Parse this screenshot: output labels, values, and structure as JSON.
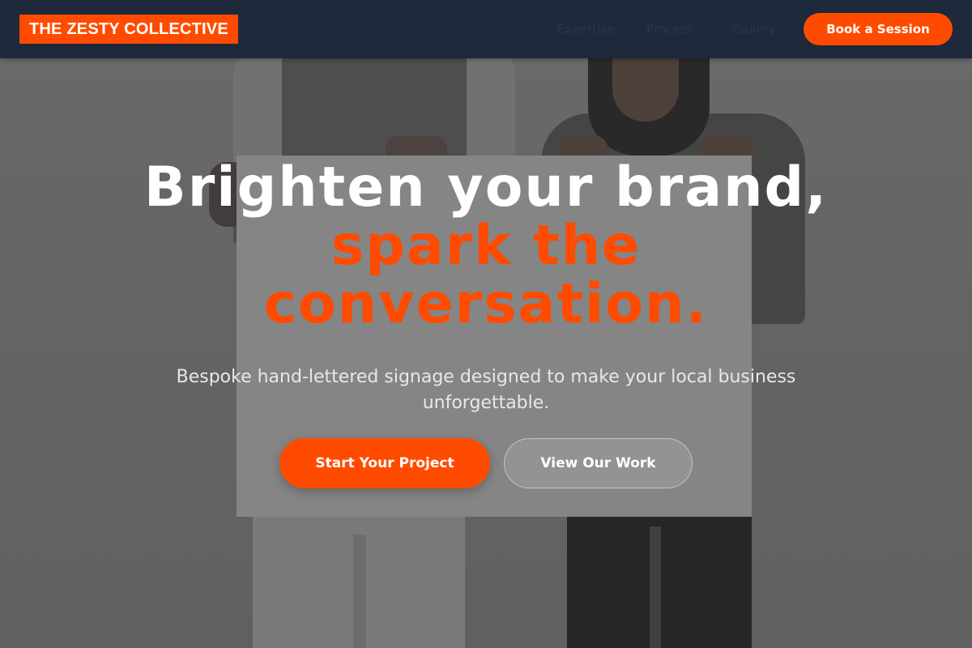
{
  "brand": {
    "name": "THE ZESTY COLLECTIVE",
    "accent_color": "#ff4b00",
    "nav_background": "#1e293b"
  },
  "nav": {
    "links": [
      "Expertise",
      "Process",
      "Gallery"
    ],
    "cta_label": "Book a Session"
  },
  "hero": {
    "headline_part1": "Brighten your brand, ",
    "headline_accent": "spark the conversation.",
    "subheadline": "Bespoke hand-lettered signage designed to make your local business unforgettable.",
    "primary_cta": "Start Your Project",
    "secondary_cta": "View Our Work",
    "background_image": "two people holding a blank sign"
  }
}
